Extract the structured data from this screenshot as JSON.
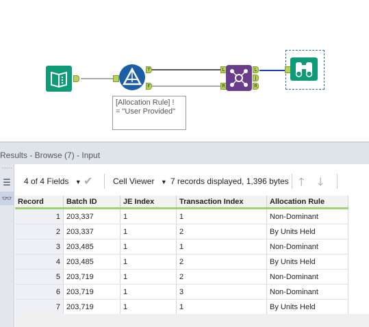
{
  "workflow": {
    "annotation_lines": [
      "[Allocation Rule] !",
      "= \"User Provided\""
    ],
    "filter_anchors": {
      "true": "T",
      "false": "F"
    },
    "join_anchors": {
      "left_in": "L",
      "right_in": "R",
      "left_out": "L",
      "join_out": "J",
      "right_out": "R"
    }
  },
  "results": {
    "title": "Results - Browse (7) - Input",
    "fields_label": "4 of 4 Fields",
    "viewer_label": "Cell Viewer",
    "summary": "7 records displayed, 1,396 bytes"
  },
  "table": {
    "columns": [
      "Record",
      "Batch ID",
      "JE Index",
      "Transaction Index",
      "Allocation Rule"
    ],
    "rows": [
      [
        "1",
        "203,337",
        "1",
        "1",
        "Non-Dominant"
      ],
      [
        "2",
        "203,337",
        "1",
        "2",
        "By Units Held"
      ],
      [
        "3",
        "203,485",
        "1",
        "1",
        "Non-Dominant"
      ],
      [
        "4",
        "203,485",
        "1",
        "2",
        "By Units Held"
      ],
      [
        "5",
        "203,719",
        "1",
        "2",
        "Non-Dominant"
      ],
      [
        "6",
        "203,719",
        "1",
        "3",
        "Non-Dominant"
      ],
      [
        "7",
        "203,719",
        "1",
        "1",
        "By Units Held"
      ]
    ]
  },
  "colors": {
    "input_tool": "#0f9a78",
    "filter_tool": "#1b5ea6",
    "join_tool": "#6a3d8c",
    "anchor": "#b6d35a",
    "header_accent": "#9dd36c"
  }
}
